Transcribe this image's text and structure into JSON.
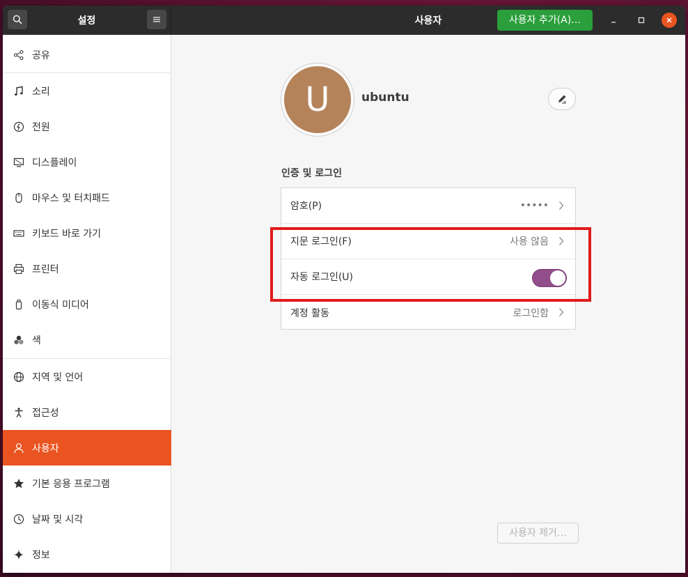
{
  "header": {
    "left_title": "설정",
    "title": "사용자",
    "add_user_label": "사용자 추가(A)…"
  },
  "sidebar": {
    "items": [
      {
        "label": "공유",
        "icon": "share-icon"
      },
      {
        "label": "소리",
        "icon": "music-note-icon"
      },
      {
        "label": "전원",
        "icon": "power-icon"
      },
      {
        "label": "디스플레이",
        "icon": "display-icon"
      },
      {
        "label": "마우스 및 터치패드",
        "icon": "mouse-icon"
      },
      {
        "label": "키보드 바로 가기",
        "icon": "keyboard-icon"
      },
      {
        "label": "프린터",
        "icon": "printer-icon"
      },
      {
        "label": "이동식 미디어",
        "icon": "usb-drive-icon"
      },
      {
        "label": "색",
        "icon": "color-icon"
      },
      {
        "label": "지역 및 언어",
        "icon": "globe-icon"
      },
      {
        "label": "접근성",
        "icon": "accessibility-icon"
      },
      {
        "label": "사용자",
        "icon": "user-icon",
        "active": true
      },
      {
        "label": "기본 응용 프로그램",
        "icon": "star-icon"
      },
      {
        "label": "날짜 및 시각",
        "icon": "clock-icon"
      },
      {
        "label": "정보",
        "icon": "info-sparkle-icon"
      }
    ]
  },
  "user": {
    "avatar_letter": "U",
    "name": "ubuntu"
  },
  "auth": {
    "section_title": "인증 및 로그인",
    "password_label": "암호(P)",
    "password_value": "•••••",
    "fingerprint_label": "지문 로그인(F)",
    "fingerprint_value": "사용 않음",
    "autologin_label": "자동 로그인(U)",
    "autologin_enabled": true,
    "activity_label": "계정 활동",
    "activity_value": "로그인함"
  },
  "remove_user_label": "사용자 제거…",
  "colors": {
    "accent": "#e95420",
    "toggle_on": "#924d8b",
    "add_button": "#2a9f3b",
    "highlight": "#e11b1b"
  }
}
